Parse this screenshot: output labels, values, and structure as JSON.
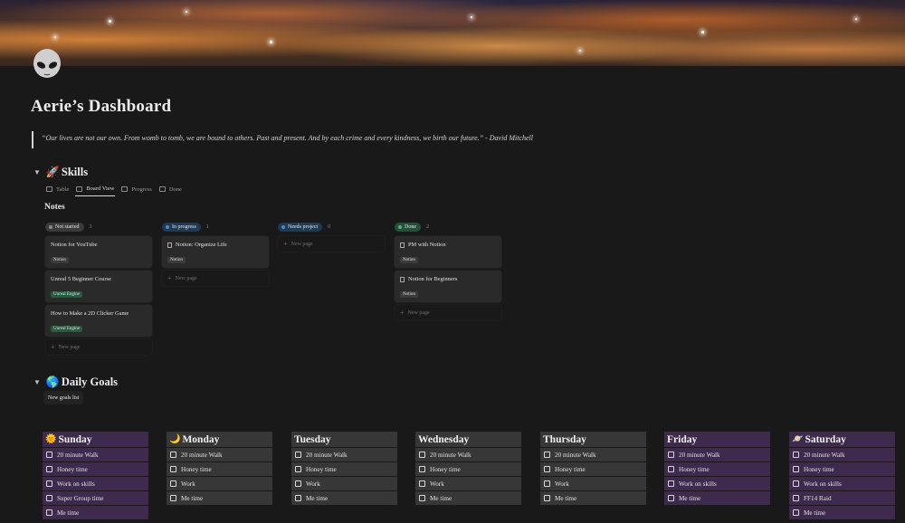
{
  "page": {
    "title": "Aerie’s Dashboard",
    "quote": "“Our lives are not our own.  From womb to tomb, we are bound to others.  Past and present.  And by each crime and every kindness, we birth our future.” - David Mitchell"
  },
  "skills": {
    "heading": "Skills",
    "emoji": "🚀",
    "views": [
      {
        "label": "Table",
        "active": false
      },
      {
        "label": "Board View",
        "active": true
      },
      {
        "label": "Progress",
        "active": false
      },
      {
        "label": "Done",
        "active": false
      }
    ],
    "board_title": "Notes",
    "new_page_label": "New page",
    "columns": [
      {
        "status": "Not started",
        "count": "3",
        "pill_color": "#3a3a3a",
        "dot_color": "#8a8a8a",
        "cards": [
          {
            "title": "Notion for YouTube",
            "tag": "Notion",
            "tag_type": "notion",
            "doc_icon": false
          },
          {
            "title": "Unreal 5 Beginner Course",
            "tag": "Unreal Engine",
            "tag_type": "unreal",
            "doc_icon": false
          },
          {
            "title": "How to Make a 2D Clicker Game",
            "tag": "Unreal Engine",
            "tag_type": "unreal",
            "doc_icon": false
          }
        ]
      },
      {
        "status": "In progress",
        "count": "1",
        "pill_color": "#1f3a55",
        "dot_color": "#4b8ad0",
        "cards": [
          {
            "title": "Notion: Organize Life",
            "tag": "Notion",
            "tag_type": "notion",
            "doc_icon": true
          }
        ]
      },
      {
        "status": "Needs project",
        "count": "0",
        "pill_color": "#1f3a55",
        "dot_color": "#4b8ad0",
        "cards": []
      },
      {
        "status": "Done",
        "count": "2",
        "pill_color": "#24503a",
        "dot_color": "#4fb07a",
        "cards": [
          {
            "title": "PM with Notion",
            "tag": "Notion",
            "tag_type": "notion",
            "doc_icon": true
          },
          {
            "title": "Notion for Beginners",
            "tag": "Notion",
            "tag_type": "notion",
            "doc_icon": true
          }
        ]
      }
    ]
  },
  "daily_goals": {
    "heading": "Daily Goals",
    "emoji": "🌎",
    "button_label": "New goals list",
    "days": [
      {
        "name": "Sunday",
        "emoji": "🌞",
        "theme": "purple",
        "tasks": [
          "20 minute Walk",
          "Honey time",
          "Work on skills",
          "Super Group time",
          "Me time"
        ]
      },
      {
        "name": "Monday",
        "emoji": "🌙",
        "theme": "gray",
        "tasks": [
          "20 minute Walk",
          "Honey time",
          "Work",
          "Me time"
        ]
      },
      {
        "name": "Tuesday",
        "emoji": "",
        "theme": "gray",
        "tasks": [
          "20 minute Walk",
          "Honey time",
          "Work",
          "Me time"
        ]
      },
      {
        "name": "Wednesday",
        "emoji": "",
        "theme": "gray",
        "tasks": [
          "20 minute Walk",
          "Honey time",
          "Work",
          "Me time"
        ]
      },
      {
        "name": "Thursday",
        "emoji": "",
        "theme": "gray",
        "tasks": [
          "20 minute Walk",
          "Honey time",
          "Work",
          "Me time"
        ]
      },
      {
        "name": "Friday",
        "emoji": "",
        "theme": "purple",
        "tasks": [
          "20 minute Walk",
          "Honey time",
          "Work on skills",
          "Me time"
        ]
      },
      {
        "name": "Saturday",
        "emoji": "🪐",
        "theme": "purple",
        "tasks": [
          "20 minute Walk",
          "Honey time",
          "Work on skills",
          "FF14 Raid",
          "Me time"
        ]
      }
    ]
  },
  "colors": {
    "background": "#191919",
    "purple_block": "#3e2a4c",
    "gray_block": "#373737",
    "card": "#2a2a2a"
  }
}
